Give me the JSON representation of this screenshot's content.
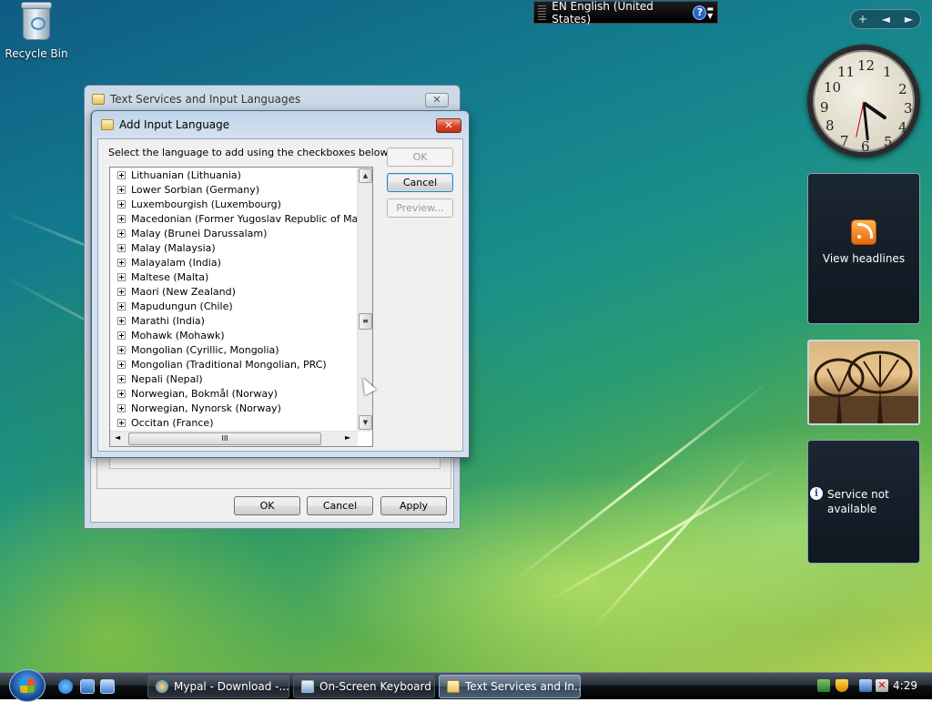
{
  "desktop": {
    "recycle_bin_label": "Recycle Bin"
  },
  "language_bar": {
    "text": "EN English (United States)",
    "help_icon": "?"
  },
  "sidebar": {
    "controls": [
      "+",
      "◄",
      "►"
    ],
    "clock_numbers": [
      "12",
      "1",
      "2",
      "3",
      "4",
      "5",
      "6",
      "7",
      "8",
      "9",
      "10",
      "11"
    ],
    "feed_gadget_label": "View headlines",
    "weather_gadget_text": "Service not available",
    "info_icon": "i"
  },
  "back_window": {
    "title": "Text Services and Input Languages",
    "close_label": "✕",
    "buttons": {
      "ok": "OK",
      "cancel": "Cancel",
      "apply": "Apply"
    }
  },
  "dialog": {
    "title": "Add Input Language",
    "close_label": "✕",
    "instruction": "Select the language to add using the checkboxes below.",
    "buttons": {
      "ok": "OK",
      "cancel": "Cancel",
      "preview": "Preview..."
    },
    "languages": [
      "Lithuanian (Lithuania)",
      "Lower Sorbian (Germany)",
      "Luxembourgish (Luxembourg)",
      "Macedonian (Former Yugoslav Republic of Macedon",
      "Malay (Brunei Darussalam)",
      "Malay (Malaysia)",
      "Malayalam (India)",
      "Maltese (Malta)",
      "Maori (New Zealand)",
      "Mapudungun (Chile)",
      "Marathi (India)",
      "Mohawk (Mohawk)",
      "Mongolian (Cyrillic, Mongolia)",
      "Mongolian (Traditional Mongolian, PRC)",
      "Nepali (Nepal)",
      "Norwegian, Bokmål (Norway)",
      "Norwegian, Nynorsk (Norway)",
      "Occitan (France)"
    ],
    "scroll_thumb_glyph": "≡",
    "hscroll_thumb_glyph": "III",
    "scroll_up": "▲",
    "scroll_down": "▼",
    "scroll_left": "◄",
    "scroll_right": "►"
  },
  "taskbar": {
    "tasks": [
      {
        "label": "Mypal - Download -...",
        "icon": "browser-icon"
      },
      {
        "label": "On-Screen Keyboard",
        "icon": "keyboard-icon"
      },
      {
        "label": "Text Services and In...",
        "icon": "text-services-icon"
      }
    ],
    "active_task": 2,
    "clock": "4:29"
  },
  "colors": {
    "taskbar_active": "#4d5f73",
    "dialog_frame": "#d3e1ef",
    "close_red": "#d8432a"
  }
}
